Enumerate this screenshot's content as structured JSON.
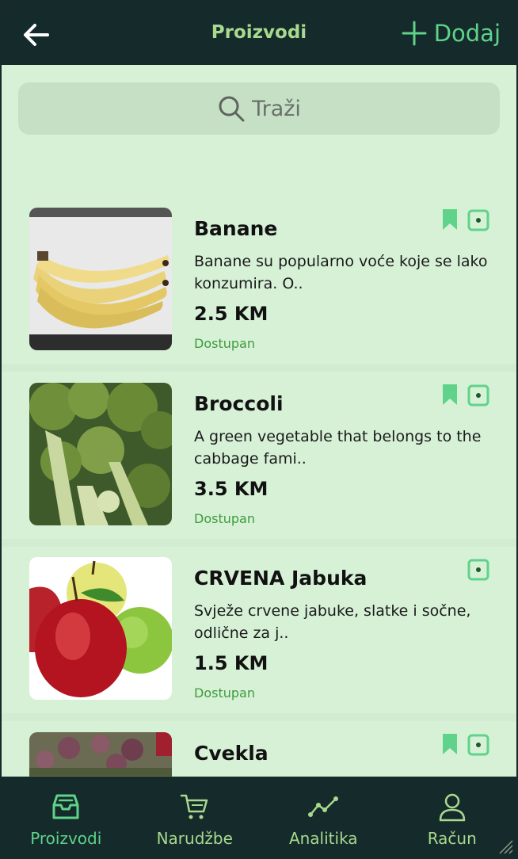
{
  "header": {
    "title": "Proizvodi",
    "add_label": "Dodaj"
  },
  "search": {
    "placeholder": "Traži"
  },
  "products": [
    {
      "name": "Banane",
      "description": "Banane su popularno voće koje se lako konzumira. O..",
      "price": "2.5 KM",
      "status": "Dostupan",
      "bookmarked": true,
      "image": "bananas"
    },
    {
      "name": "Broccoli",
      "description": "A green vegetable that belongs to the cabbage fami..",
      "price": "3.5 KM",
      "status": "Dostupan",
      "bookmarked": true,
      "image": "broccoli"
    },
    {
      "name": "CRVENA Jabuka",
      "description": "Svježe crvene jabuke, slatke i sočne, odlične za j..",
      "price": "1.5 KM",
      "status": "Dostupan",
      "bookmarked": false,
      "image": "apples"
    },
    {
      "name": "Cvekla",
      "description": "",
      "price": "",
      "status": "",
      "bookmarked": true,
      "image": "beets"
    }
  ],
  "nav": {
    "items": [
      {
        "label": "Proizvodi",
        "icon": "inbox-icon",
        "active": true
      },
      {
        "label": "Narudžbe",
        "icon": "cart-icon",
        "active": false
      },
      {
        "label": "Analitika",
        "icon": "analytics-icon",
        "active": false
      },
      {
        "label": "Račun",
        "icon": "user-icon",
        "active": false
      }
    ]
  },
  "colors": {
    "header_bg": "#152a2b",
    "page_bg": "#d7f1d7",
    "accent": "#5fd38a",
    "title": "#a8d98e",
    "status": "#3f9a3f"
  }
}
